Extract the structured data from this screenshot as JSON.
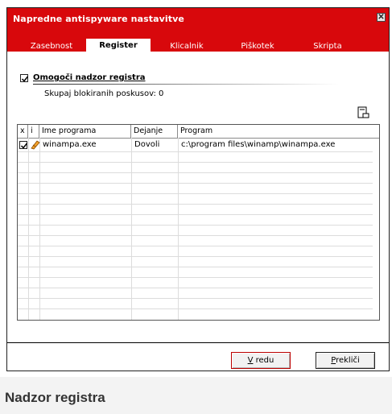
{
  "window": {
    "title": "Napredne antispyware nastavitve"
  },
  "tabs": [
    {
      "label": "Zasebnost",
      "active": false
    },
    {
      "label": "Register",
      "active": true
    },
    {
      "label": "Klicalnik",
      "active": false
    },
    {
      "label": "Piškotek",
      "active": false
    },
    {
      "label": "Skripta",
      "active": false
    }
  ],
  "registry": {
    "enable_label": "Omogoči nadzor registra",
    "enabled": true,
    "blocked_text": "Skupaj blokiranih poskusov: 0"
  },
  "table": {
    "headers": [
      "x",
      "i",
      "Ime programa",
      "Dejanje",
      "Program"
    ],
    "rows": [
      {
        "checked": true,
        "icon": "winamp-icon",
        "name": "winampa.exe",
        "action": "Dovoli",
        "path": "c:\\program files\\winamp\\winampa.exe"
      }
    ]
  },
  "buttons": {
    "ok_underline": "V",
    "ok_rest": " redu",
    "cancel_underline": "P",
    "cancel_rest": "rekliči"
  },
  "caption": "Nadzor registra",
  "icons": {
    "close": "close-icon",
    "export": "export-icon"
  },
  "colors": {
    "titlebar": "#d8080c"
  }
}
